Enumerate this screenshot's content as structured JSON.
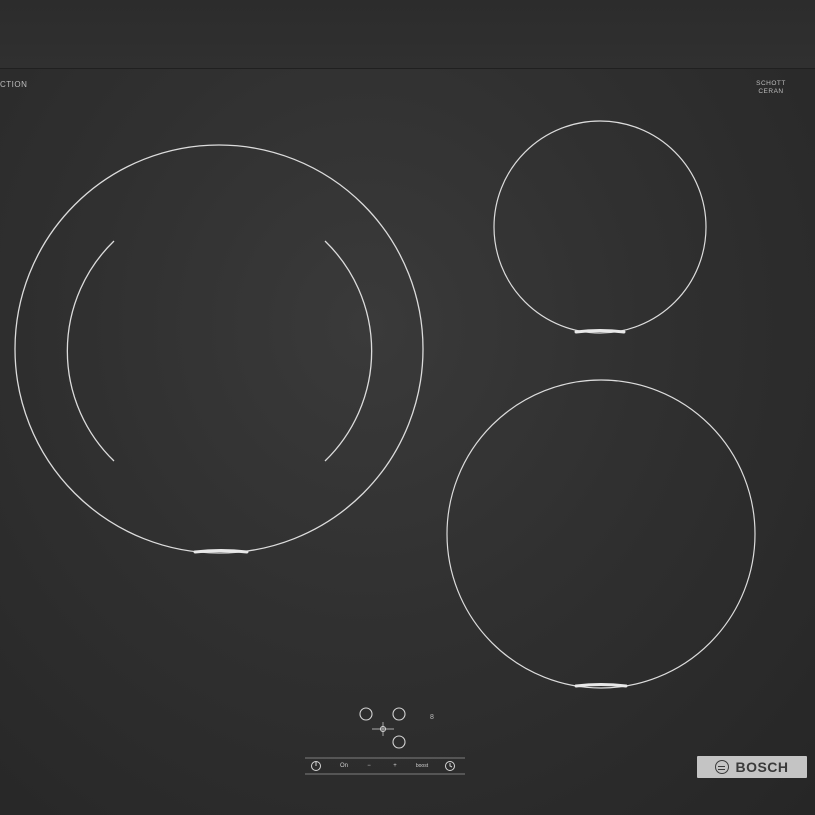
{
  "cooktop": {
    "induction_label": "CTION",
    "schott_brand": "SCHOTT\nCERAN",
    "schott_sub": "",
    "brand": "BOSCH",
    "display_digit": "8",
    "small_mark": "",
    "controls": {
      "power_icon": "power-icon",
      "on_label": "On",
      "minus_label": "−",
      "plus_label": "+",
      "boost_label": "boost",
      "timer_icon": "timer-icon"
    }
  },
  "colors": {
    "glass": "#2e2e2e",
    "ring": "#d9d9d9",
    "badge": "#c4c4c4"
  }
}
